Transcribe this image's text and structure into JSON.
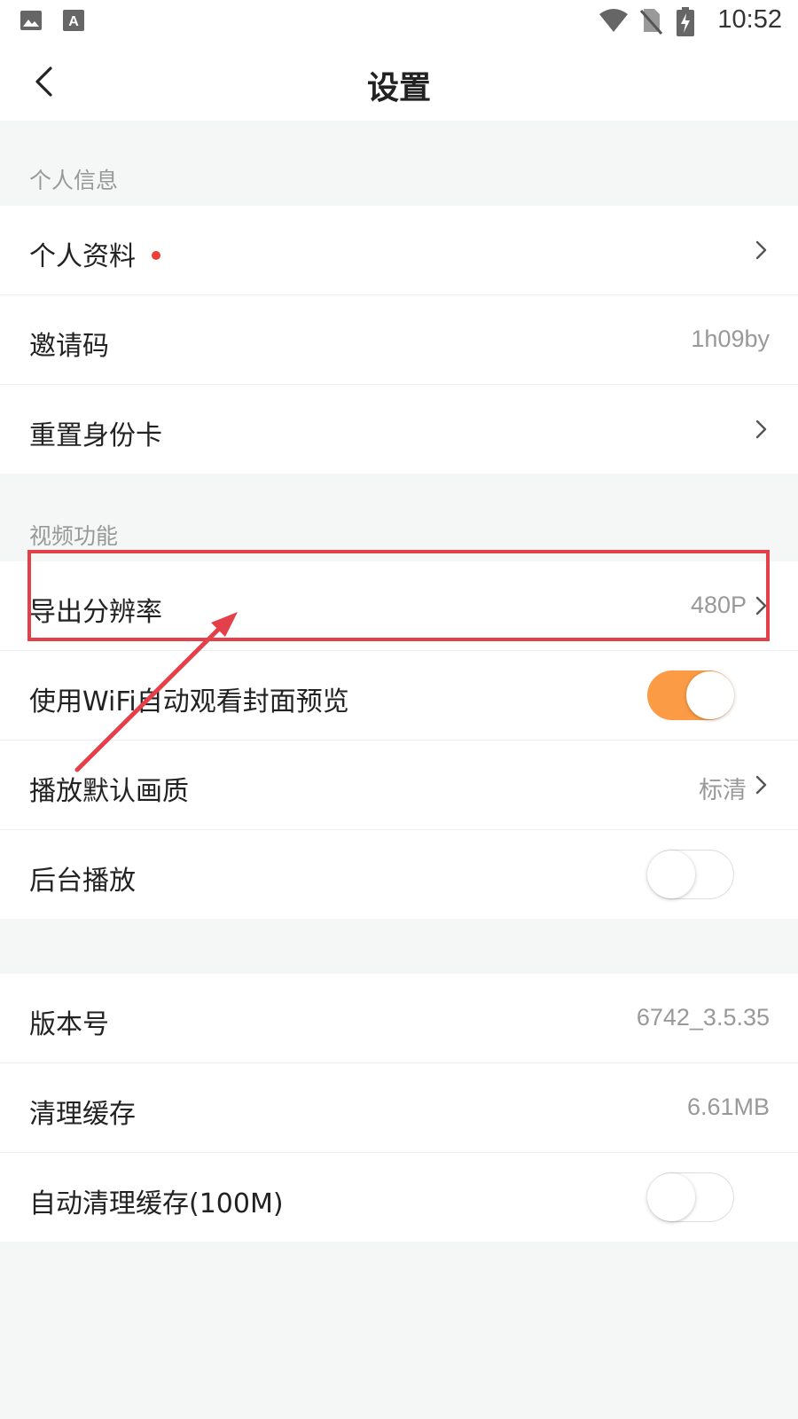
{
  "status_bar": {
    "time": "10:52",
    "icons": [
      "image-icon",
      "text-a-icon",
      "wifi-icon",
      "no-sim-icon",
      "battery-charging-icon"
    ]
  },
  "header": {
    "title": "设置",
    "back_icon": "back-chevron-icon"
  },
  "sections": {
    "personal": {
      "label": "个人信息",
      "rows": {
        "profile": {
          "label": "个人资料",
          "has_red_dot": true
        },
        "invite": {
          "label": "邀请码",
          "value": "1h09by"
        },
        "reset_id": {
          "label": "重置身份卡"
        }
      }
    },
    "video": {
      "label": "视频功能",
      "rows": {
        "export_res": {
          "label": "导出分辨率",
          "value": "480P"
        },
        "wifi_preview": {
          "label": "使用WiFi自动观看封面预览",
          "toggle": "on"
        },
        "default_quality": {
          "label": "播放默认画质",
          "value": "标清"
        },
        "background_play": {
          "label": "后台播放",
          "toggle": "off"
        }
      }
    },
    "other": {
      "rows": {
        "version": {
          "label": "版本号",
          "value": "6742_3.5.35"
        },
        "clear_cache": {
          "label": "清理缓存",
          "value": "6.61MB"
        },
        "auto_clear": {
          "label": "自动清理缓存(100M)",
          "toggle": "off"
        }
      }
    }
  },
  "colors": {
    "accent": "#fb9b45",
    "red_dot": "#f23b3b",
    "annotation": "#e4404a",
    "background": "#f5f6f6"
  }
}
